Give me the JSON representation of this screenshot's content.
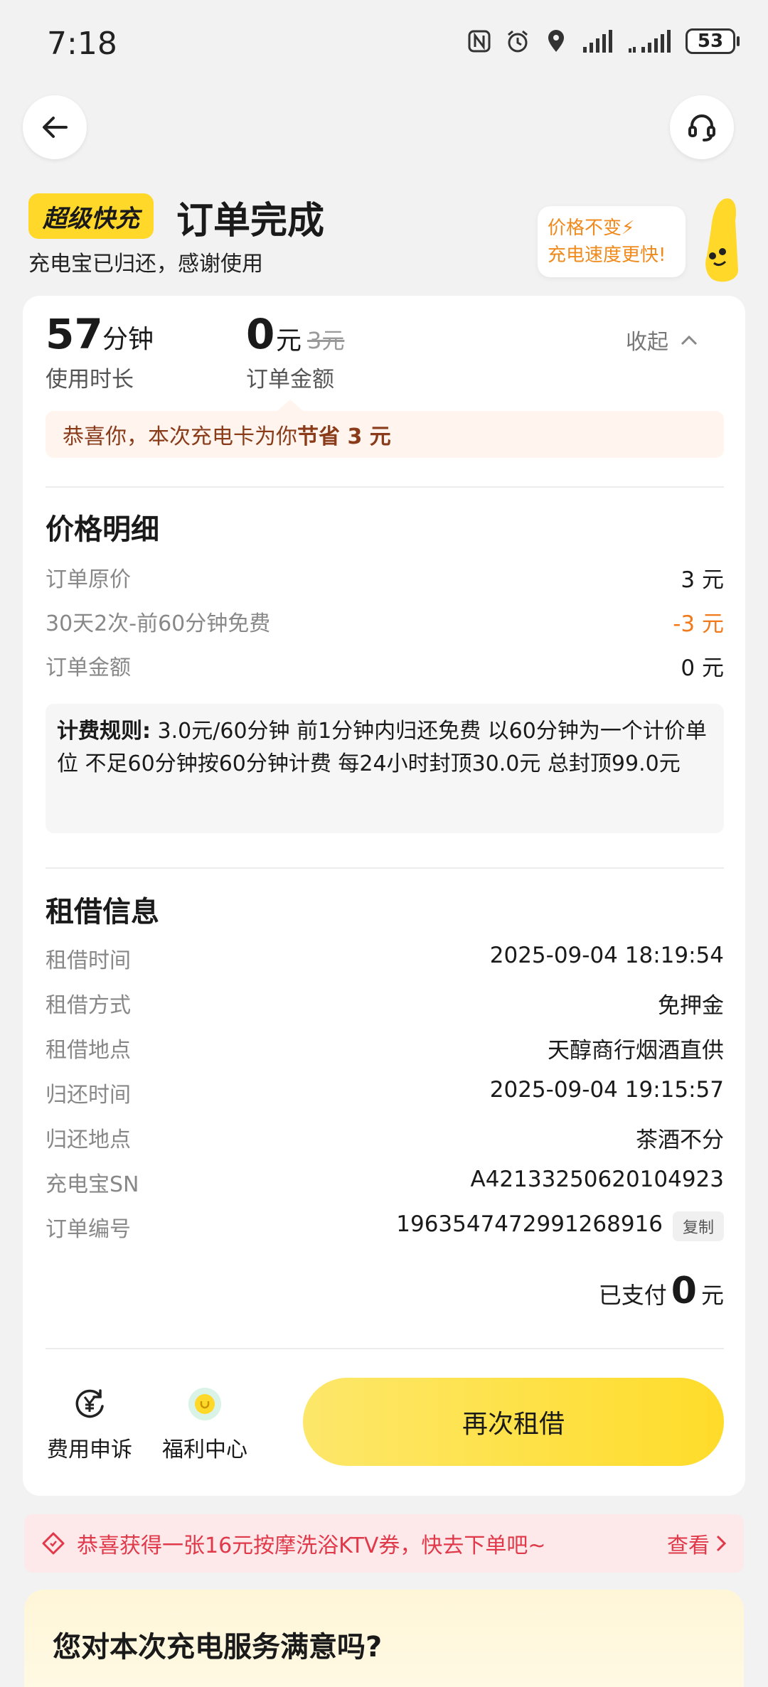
{
  "status_bar": {
    "time": "7:18",
    "battery": "53"
  },
  "header": {
    "brand_badge": "超级快充",
    "title": "订单完成",
    "subtitle": "充电宝已归还，感谢使用",
    "promo_line1": "价格不变⚡",
    "promo_line2": "充电速度更快!"
  },
  "summary": {
    "duration_value": "57",
    "duration_unit": "分钟",
    "duration_label": "使用时长",
    "amount_value": "0",
    "amount_unit": "元",
    "amount_original": "3元",
    "amount_label": "订单金额",
    "collapse_label": "收起",
    "saving_prefix": "恭喜你，本次充电卡为你",
    "saving_highlight": "节省 3 元"
  },
  "price_detail": {
    "title": "价格明细",
    "rows": [
      {
        "label": "订单原价",
        "value": "3 元"
      },
      {
        "label": "30天2次-前60分钟免费",
        "value": "-3 元"
      },
      {
        "label": "订单金额",
        "value": "0 元"
      }
    ],
    "rule_label": "计费规则:",
    "rule_text": " 3.0元/60分钟 前1分钟内归还免费 以60分钟为一个计价单位 不足60分钟按60分钟计费 每24小时封顶30.0元 总封顶99.0元"
  },
  "rental_info": {
    "title": "租借信息",
    "rows": [
      {
        "label": "租借时间",
        "value": "2025-09-04 18:19:54"
      },
      {
        "label": "租借方式",
        "value": "免押金"
      },
      {
        "label": "租借地点",
        "value": "天醇商行烟酒直供"
      },
      {
        "label": "归还时间",
        "value": "2025-09-04 19:15:57"
      },
      {
        "label": "归还地点",
        "value": "茶酒不分"
      },
      {
        "label": "充电宝SN",
        "value": "A42133250620104923"
      },
      {
        "label": "订单编号",
        "value": "1963547472991268916"
      }
    ],
    "copy_label": "复制",
    "paid_label": "已支付",
    "paid_value": "0",
    "paid_unit": "元"
  },
  "actions": {
    "appeal_label": "费用申诉",
    "welfare_label": "福利中心",
    "rent_again_label": "再次租借"
  },
  "coupon": {
    "text": "恭喜获得一张16元按摩洗浴KTV券，快去下单吧~",
    "link": "查看"
  },
  "survey": {
    "title": "您对本次充电服务满意吗?"
  },
  "colors": {
    "accent_yellow": "#ffd829",
    "discount_orange": "#f07a1c",
    "coupon_red": "#e0394a"
  }
}
